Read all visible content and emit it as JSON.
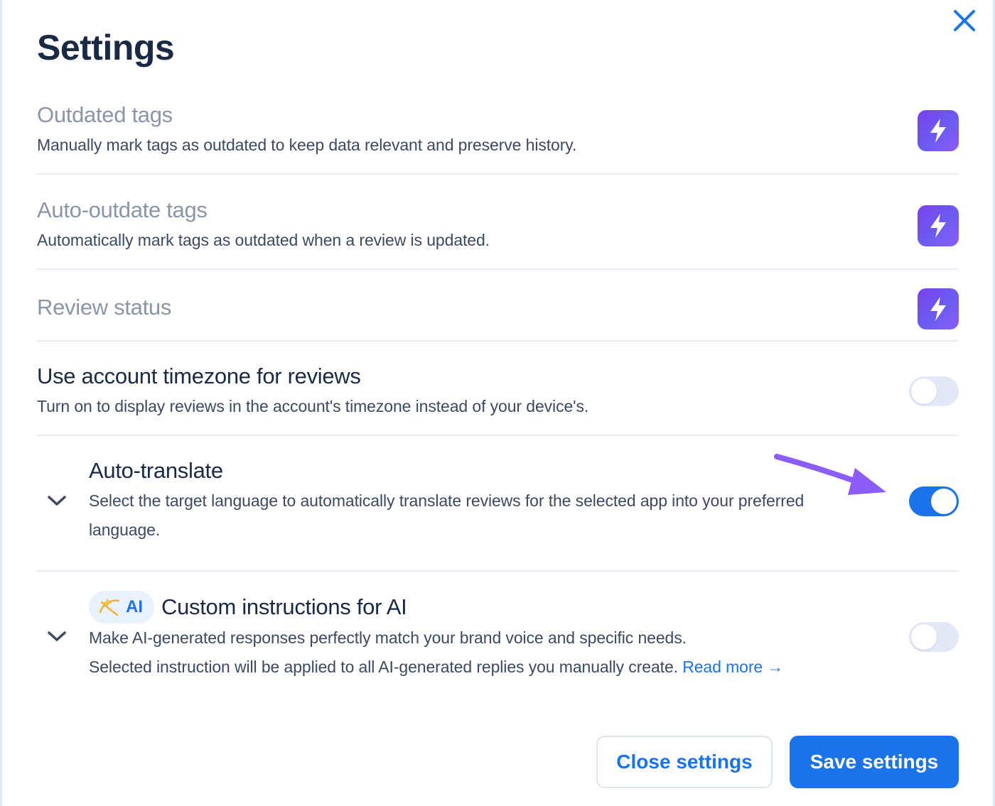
{
  "dialog": {
    "title": "Settings"
  },
  "settings": [
    {
      "title": "Outdated tags",
      "description": "Manually mark tags as outdated to keep data relevant and preserve history.",
      "control": "upgrade-bolt-icon"
    },
    {
      "title": "Auto-outdate tags",
      "description": "Automatically mark tags as outdated when a review is updated.",
      "control": "upgrade-bolt-icon"
    },
    {
      "title": "Review status",
      "control": "upgrade-bolt-icon"
    },
    {
      "title": "Use account timezone for reviews",
      "description": "Turn on to display reviews in the account's timezone instead of your device's.",
      "toggle": "off"
    },
    {
      "title": "Auto-translate",
      "description_line1": "Select the target language to automatically translate reviews for the selected app into your preferred",
      "description_line2": "language.",
      "toggle": "on",
      "expand_icon": "chevron-down-icon"
    },
    {
      "badge": "AI",
      "title": "Custom instructions for AI",
      "description_line1": "Make AI-generated responses perfectly match your brand voice and specific needs.",
      "description_line2": "Selected instruction will be applied to all AI-generated replies you manually create.",
      "link": "Read more →",
      "toggle": "off",
      "expand_icon": "chevron-down-icon"
    }
  ],
  "footer": {
    "close_label": "Close settings",
    "save_label": "Save settings"
  },
  "colors": {
    "accent": "#1a73e8",
    "premium": "#7a3ff0",
    "annotation_arrow": "#8b5cf6"
  }
}
